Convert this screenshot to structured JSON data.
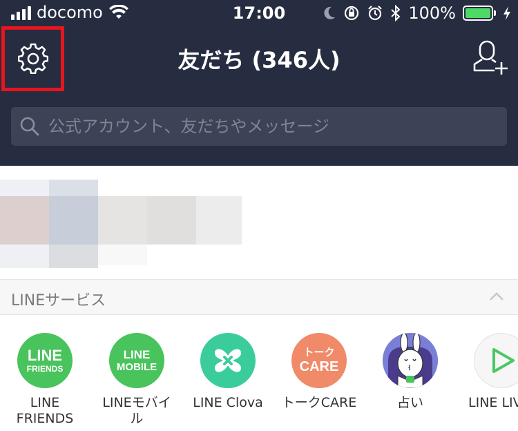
{
  "status_bar": {
    "carrier": "docomo",
    "time": "17:00",
    "battery": "100%",
    "battery_level": 1.0
  },
  "header": {
    "title": "友だち (346人)",
    "settings_icon": "gear-icon",
    "add_friend_icon": "add-friend-icon"
  },
  "search": {
    "placeholder": "公式アカウント、友だちやメッセージ"
  },
  "section": {
    "title": "LINEサービス"
  },
  "services": [
    {
      "label": "LINE\nFRIENDS",
      "logo_line1": "LINE",
      "logo_line2": "FRIENDS",
      "color": "#49c35c"
    },
    {
      "label": "LINEモバイ\nル",
      "logo_line1": "LINE",
      "logo_line2": "MOBILE",
      "color": "#49c35c"
    },
    {
      "label": "LINE Clova",
      "color": "#3bcc9b"
    },
    {
      "label": "トークCARE",
      "logo_line1": "トーク",
      "logo_line2": "CARE",
      "color": "#f08a68"
    },
    {
      "label": "占い",
      "color": "#7a7fd6"
    },
    {
      "label": "LINE LIVE",
      "color": "#4cc764"
    }
  ]
}
